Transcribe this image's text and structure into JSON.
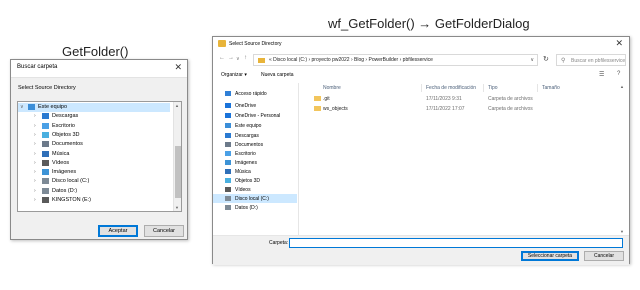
{
  "captions": {
    "left": "GetFolder()",
    "right": "wf_GetFolder() → GetFolderDialog"
  },
  "small_dialog": {
    "title": "Buscar carpeta",
    "description": "Select Source Directory",
    "tree": [
      {
        "label": "Este equipo",
        "icon": "computer-icon",
        "color": "#3b8ed8",
        "level": 0,
        "expanded": true,
        "selected": true
      },
      {
        "label": "Descargas",
        "icon": "download-icon",
        "color": "#2a7ad1",
        "level": 1
      },
      {
        "label": "Escritorio",
        "icon": "desktop-icon",
        "color": "#4aa0e6",
        "level": 1
      },
      {
        "label": "Objetos 3D",
        "icon": "cube-icon",
        "color": "#4ab0e0",
        "level": 1
      },
      {
        "label": "Documentos",
        "icon": "document-icon",
        "color": "#6c7a8a",
        "level": 1
      },
      {
        "label": "Música",
        "icon": "music-icon",
        "color": "#2f6fb8",
        "level": 1
      },
      {
        "label": "Vídeos",
        "icon": "video-icon",
        "color": "#5a5a5a",
        "level": 1
      },
      {
        "label": "Imágenes",
        "icon": "image-icon",
        "color": "#3d93d6",
        "level": 1
      },
      {
        "label": "Disco local (C:)",
        "icon": "drive-icon",
        "color": "#7d8a96",
        "level": 1
      },
      {
        "label": "Datos (D:)",
        "icon": "drive-icon",
        "color": "#7d8a96",
        "level": 1
      },
      {
        "label": "KINGSTON (E:)",
        "icon": "usb-drive-icon",
        "color": "#5a5a5a",
        "level": 1
      }
    ],
    "ok_label": "Aceptar",
    "cancel_label": "Cancelar"
  },
  "big_dialog": {
    "title": "Select Source Directory",
    "breadcrumb": "«  Disco local (C:)  ›  proyecto pw2022  ›  Blog  ›  PowerBuilder  ›  pbfilesservice",
    "search_placeholder": "Buscar en pbfilesservice",
    "organize_label": "Organizar ▾",
    "new_folder_label": "Nueva carpeta",
    "nav_items": [
      {
        "label": "Acceso rápido",
        "icon": "star-icon",
        "color": "#2f7fd6",
        "pinned": false
      },
      {
        "label": "OneDrive",
        "icon": "cloud-icon",
        "color": "#1a73d9"
      },
      {
        "label": "OneDrive - Personal",
        "icon": "cloud-icon",
        "color": "#1a73d9"
      },
      {
        "label": "Este equipo",
        "icon": "computer-icon",
        "color": "#3b8ed8"
      },
      {
        "label": "Descargas",
        "icon": "download-icon",
        "color": "#2a7ad1"
      },
      {
        "label": "Documentos",
        "icon": "document-icon",
        "color": "#6c7a8a"
      },
      {
        "label": "Escritorio",
        "icon": "desktop-icon",
        "color": "#4aa0e6"
      },
      {
        "label": "Imágenes",
        "icon": "image-icon",
        "color": "#3d93d6"
      },
      {
        "label": "Música",
        "icon": "music-icon",
        "color": "#2f6fb8"
      },
      {
        "label": "Objetos 3D",
        "icon": "cube-icon",
        "color": "#4ab0e0"
      },
      {
        "label": "Vídeos",
        "icon": "video-icon",
        "color": "#5a5a5a"
      },
      {
        "label": "Disco local (C:)",
        "icon": "drive-icon",
        "color": "#7d8a96",
        "selected": true
      },
      {
        "label": "Datos (D:)",
        "icon": "drive-icon",
        "color": "#7d8a96"
      }
    ],
    "columns": [
      "Nombre",
      "Fecha de modificación",
      "Tipo",
      "Tamaño"
    ],
    "rows": [
      {
        "name": ".git",
        "modified": "17/11/2023 9:31",
        "type": "Carpeta de archivos",
        "size": ""
      },
      {
        "name": "ws_objects",
        "modified": "17/11/2022 17:07",
        "type": "Carpeta de archivos",
        "size": ""
      }
    ],
    "folder_label": "Carpeta:",
    "folder_value": "",
    "select_label": "Seleccionar carpeta",
    "cancel_label": "Cancelar"
  }
}
